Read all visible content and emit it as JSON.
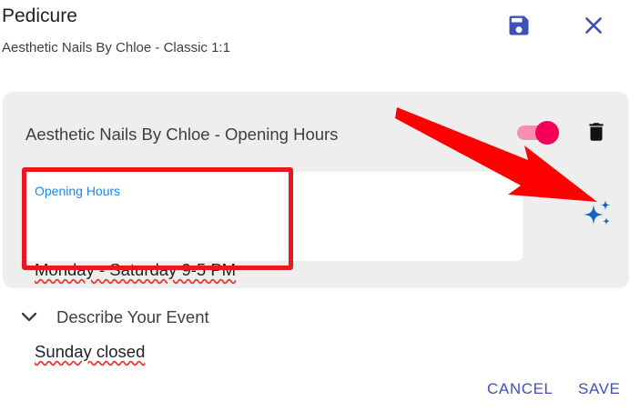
{
  "header": {
    "title": "Pedicure",
    "subtitle": "Aesthetic Nails By Chloe - Classic 1:1",
    "save_icon": "save-icon",
    "close_icon": "close-icon"
  },
  "card": {
    "title": "Aesthetic Nails By Chloe - Opening Hours",
    "toggle_on": true,
    "toggle_color": "#f50057",
    "field": {
      "label": "Opening Hours",
      "value_lines": [
        "Monday - Saturday 9-5 PM",
        "Sunday closed"
      ]
    },
    "sparkle_icon": "sparkle-icon",
    "delete_icon": "trash-icon"
  },
  "annotations": {
    "highlight_color": "#e8181e",
    "arrow_color": "#ff0000"
  },
  "section": {
    "describe_label": "Describe Your Event"
  },
  "footer": {
    "cancel_label": "CANCEL",
    "save_label": "SAVE"
  },
  "colors": {
    "accent": "#3f51b5",
    "label_blue": "#1e88e5",
    "card_bg": "#eeeeee"
  }
}
